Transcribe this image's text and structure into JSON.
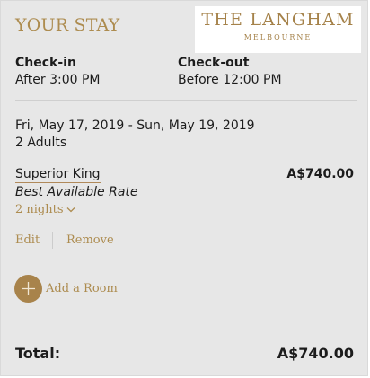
{
  "header": {
    "title": "YOUR STAY",
    "logo_name": "THE LANGHAM",
    "logo_city": "MELBOURNE"
  },
  "check_in": {
    "label": "Check-in",
    "value": "After 3:00 PM"
  },
  "check_out": {
    "label": "Check-out",
    "value": "Before 12:00 PM"
  },
  "stay": {
    "dates": "Fri, May 17, 2019 - Sun, May 19, 2019",
    "guests": "2 Adults"
  },
  "room": {
    "name": "Superior King",
    "rate": "Best Available Rate",
    "price": "A$740.00",
    "nights": "2 nights",
    "nights_icon": "chevron-down-icon",
    "edit_label": "Edit",
    "remove_label": "Remove"
  },
  "add_room": {
    "label": "Add a Room",
    "icon": "plus-icon"
  },
  "total": {
    "label": "Total:",
    "value": "A$740.00"
  },
  "colors": {
    "accent": "#ad8c50",
    "panel_bg": "#e7e7e7",
    "add_button": "#a8834b"
  }
}
